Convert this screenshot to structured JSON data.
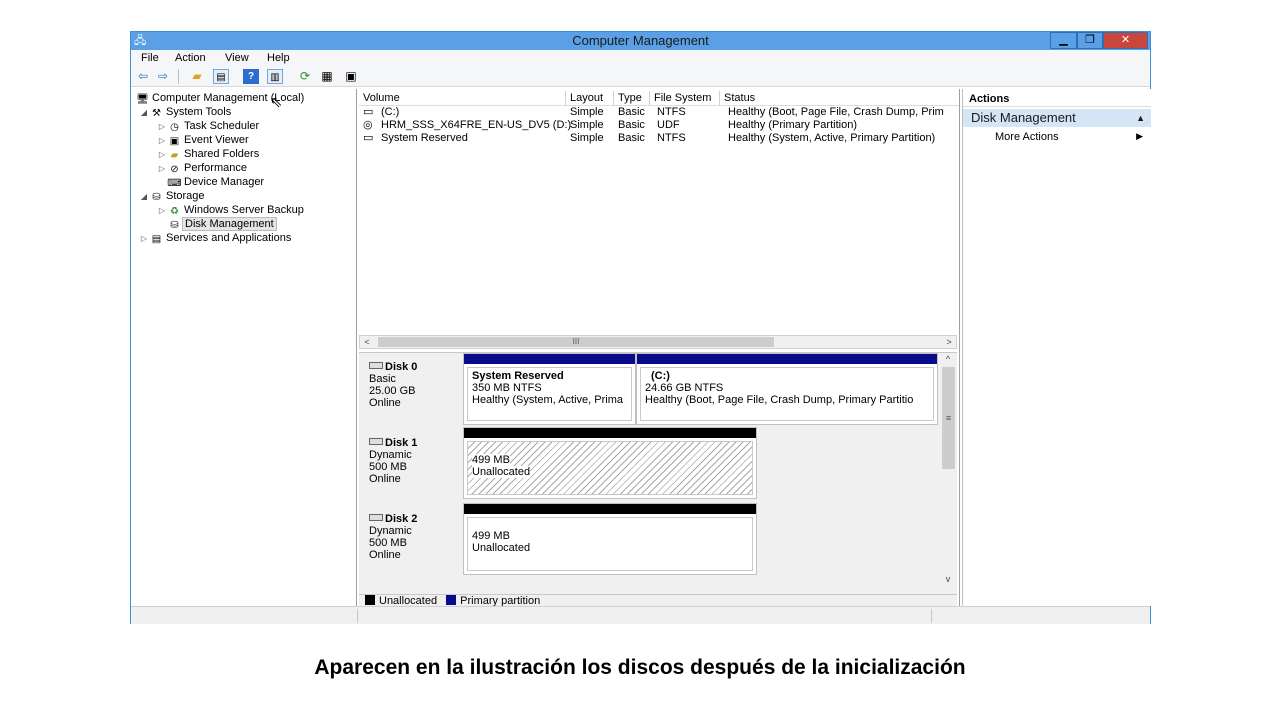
{
  "window": {
    "title": "Computer Management"
  },
  "menu": [
    "File",
    "Action",
    "View",
    "Help"
  ],
  "toolbar": {
    "icons": [
      "back-arrow-icon",
      "forward-arrow-icon",
      "folder-up-icon",
      "show-hide-tree-icon",
      "help-icon",
      "show-hide-action-pane-icon",
      "refresh-icon",
      "properties-icon",
      "settings-icon"
    ]
  },
  "tree": [
    {
      "label": "Computer Management (Local)",
      "expander": "",
      "icon": "computer-icon"
    },
    {
      "label": "System Tools",
      "expander": "◢",
      "icon": "tools-icon"
    },
    {
      "label": "Task Scheduler",
      "expander": "▷",
      "icon": "clock-icon"
    },
    {
      "label": "Event Viewer",
      "expander": "▷",
      "icon": "event-viewer-icon"
    },
    {
      "label": "Shared Folders",
      "expander": "▷",
      "icon": "shared-folder-icon"
    },
    {
      "label": "Performance",
      "expander": "▷",
      "icon": "performance-icon"
    },
    {
      "label": "Device Manager",
      "expander": "",
      "icon": "device-manager-icon"
    },
    {
      "label": "Storage",
      "expander": "◢",
      "icon": "storage-icon"
    },
    {
      "label": "Windows Server Backup",
      "expander": "▷",
      "icon": "backup-icon"
    },
    {
      "label": "Disk Management",
      "expander": "",
      "icon": "disk-management-icon"
    },
    {
      "label": "Services and Applications",
      "expander": "▷",
      "icon": "services-icon"
    }
  ],
  "volumes": {
    "headers": [
      "Volume",
      "Layout",
      "Type",
      "File System",
      "Status"
    ],
    "rows": [
      {
        "volume": "(C:)",
        "layout": "Simple",
        "type": "Basic",
        "fs": "NTFS",
        "status": "Healthy (Boot, Page File, Crash Dump, Prim"
      },
      {
        "volume": "HRM_SSS_X64FRE_EN-US_DV5 (D:)",
        "layout": "Simple",
        "type": "Basic",
        "fs": "UDF",
        "status": "Healthy (Primary Partition)"
      },
      {
        "volume": "System Reserved",
        "layout": "Simple",
        "type": "Basic",
        "fs": "NTFS",
        "status": "Healthy (System, Active, Primary Partition)"
      }
    ]
  },
  "scroll": {
    "left": "<",
    "right": ">",
    "grip": "III",
    "up": "^",
    "down": "v",
    "vgrip": "≡"
  },
  "disks": [
    {
      "name": "Disk 0",
      "kind": "Basic",
      "size": "25.00 GB",
      "state": "Online",
      "partitions": [
        {
          "title": "System Reserved",
          "line1": "350 MB NTFS",
          "line2": "Healthy (System, Active, Prima",
          "bar_color": "#0a0a8c",
          "hatched": false
        },
        {
          "title": "(C:)",
          "line1": "24.66 GB NTFS",
          "line2": "Healthy (Boot, Page File, Crash Dump, Primary Partitio",
          "bar_color": "#0a0a8c",
          "hatched": false
        }
      ]
    },
    {
      "name": "Disk 1",
      "kind": "Dynamic",
      "size": "500 MB",
      "state": "Online",
      "partitions": [
        {
          "title": "",
          "line1": "499 MB",
          "line2": "Unallocated",
          "bar_color": "#000000",
          "hatched": true
        }
      ]
    },
    {
      "name": "Disk 2",
      "kind": "Dynamic",
      "size": "500 MB",
      "state": "Online",
      "partitions": [
        {
          "title": "",
          "line1": "499 MB",
          "line2": "Unallocated",
          "bar_color": "#000000",
          "hatched": false
        }
      ]
    }
  ],
  "legend": [
    {
      "label": "Unallocated",
      "color": "#000000"
    },
    {
      "label": "Primary partition",
      "color": "#0a0a8c"
    }
  ],
  "actions": {
    "title": "Actions",
    "section": "Disk Management",
    "more": "More Actions"
  },
  "caption": "Aparecen en la ilustración los discos después de la inicialización",
  "colors": {
    "titlebar": "#5ba0e6",
    "close": "#c9463d",
    "primary": "#0a0a8c"
  }
}
